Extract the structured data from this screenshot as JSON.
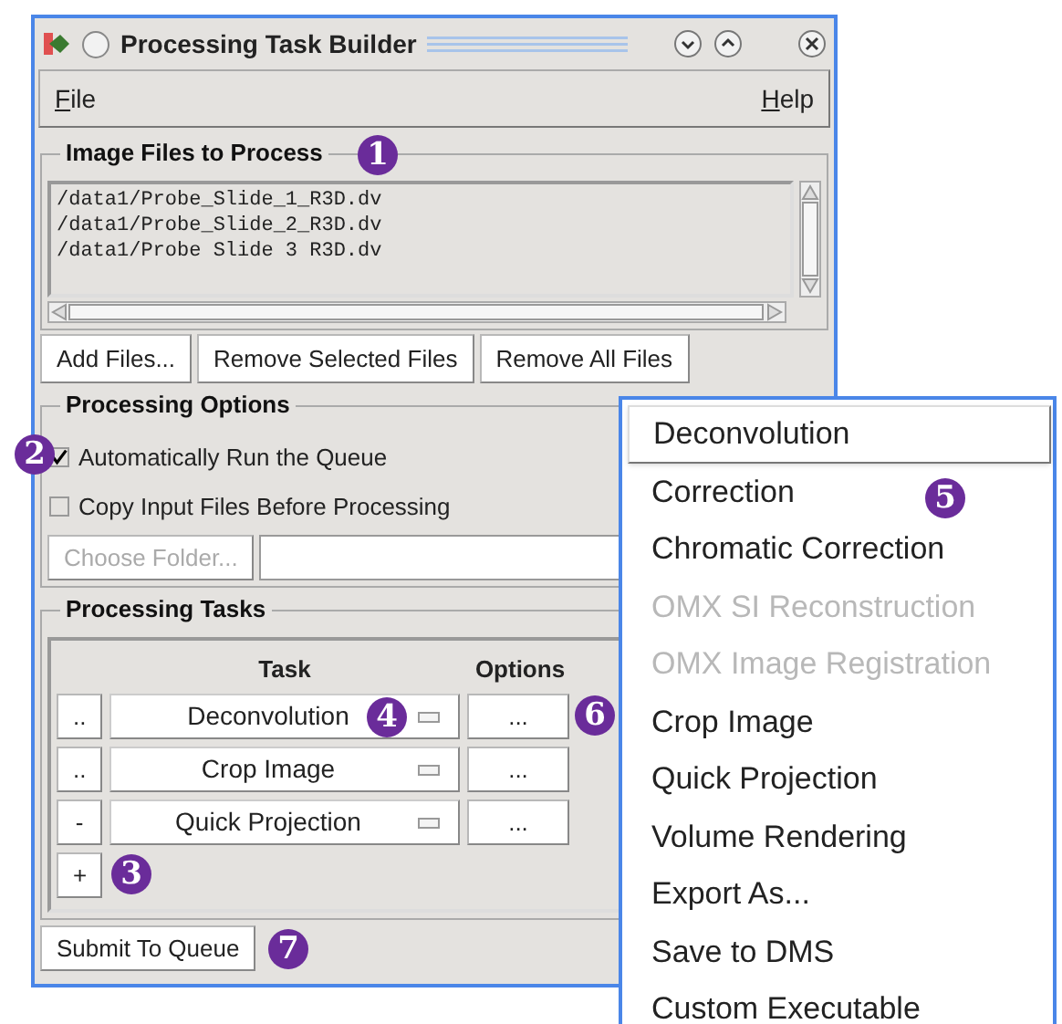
{
  "window": {
    "title": "Processing Task Builder"
  },
  "menubar": [
    {
      "label": "File"
    },
    {
      "label": "Help"
    }
  ],
  "image_files": {
    "title": "Image Files to Process",
    "callout": "1",
    "files": [
      "/data1/Probe_Slide_1_R3D.dv",
      "/data1/Probe_Slide_2_R3D.dv",
      "/data1/Probe Slide 3 R3D.dv"
    ]
  },
  "file_buttons": [
    "Add Files...",
    "Remove Selected Files",
    "Remove All Files"
  ],
  "processing_options": {
    "title": "Processing Options",
    "callout": "2",
    "items": [
      {
        "label": "Automatically Run the Queue",
        "checked": true
      },
      {
        "label": "Copy Input Files Before Processing",
        "checked": false
      }
    ],
    "choose_folder": {
      "label": "Choose Folder...",
      "disabled": true
    }
  },
  "processing_tasks": {
    "title": "Processing Tasks",
    "columns": [
      "Task",
      "Options"
    ],
    "rows": [
      {
        "remove": "..",
        "task": "Deconvolution",
        "options": "...",
        "task_callout": "4",
        "options_callout": "6"
      },
      {
        "remove": "..",
        "task": "Crop Image",
        "options": "..."
      },
      {
        "remove": "-",
        "task": "Quick Projection",
        "options": "..."
      }
    ],
    "add": "+",
    "add_callout": "3"
  },
  "submit": {
    "label": "Submit To Queue",
    "callout": "7"
  },
  "task_menu": {
    "callout": "5",
    "items": [
      {
        "label": "Deconvolution",
        "disabled": false,
        "selected": true
      },
      {
        "label": "Correction",
        "disabled": false,
        "selected": false
      },
      {
        "label": "Chromatic Correction",
        "disabled": false,
        "selected": false
      },
      {
        "label": "OMX SI Reconstruction",
        "disabled": true,
        "selected": false
      },
      {
        "label": "OMX Image Registration",
        "disabled": true,
        "selected": false
      },
      {
        "label": "Crop Image",
        "disabled": false,
        "selected": false
      },
      {
        "label": "Quick Projection",
        "disabled": false,
        "selected": false
      },
      {
        "label": "Volume Rendering",
        "disabled": false,
        "selected": false
      },
      {
        "label": "Export As...",
        "disabled": false,
        "selected": false
      },
      {
        "label": "Save to DMS",
        "disabled": false,
        "selected": false
      },
      {
        "label": "Custom Executable",
        "disabled": false,
        "selected": false
      }
    ]
  }
}
